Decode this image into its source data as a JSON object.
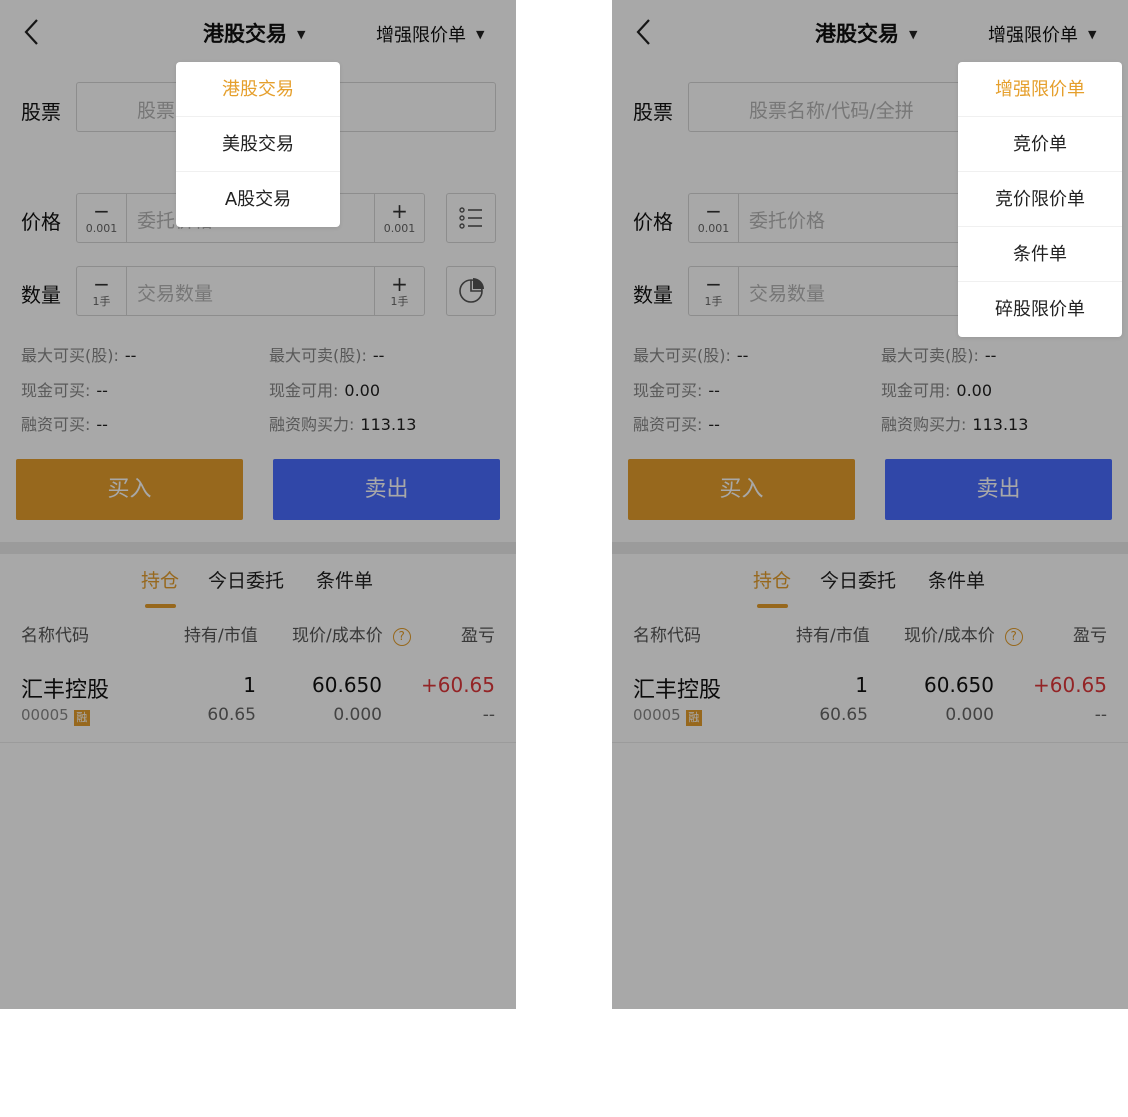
{
  "left": {
    "nav": {
      "title": "港股交易",
      "order_type": "增强限价单"
    },
    "form": {
      "stock_label": "股票",
      "stock_placeholder": "股票名称/代码/全拼",
      "price_label": "价格",
      "price_step": "0.001",
      "price_placeholder": "委托价格",
      "qty_label": "数量",
      "qty_step": "1手",
      "qty_placeholder": "交易数量"
    },
    "stats": {
      "max_buy_label": "最大可买(股):",
      "max_buy": "--",
      "max_sell_label": "最大可卖(股):",
      "max_sell": "--",
      "cash_buy_label": "现金可买:",
      "cash_buy": "--",
      "cash_avail_label": "现金可用:",
      "cash_avail": "0.00",
      "margin_buy_label": "融资可买:",
      "margin_buy": "--",
      "margin_power_label": "融资购买力:",
      "margin_power": "113.13"
    },
    "actions": {
      "buy": "买入",
      "sell": "卖出"
    },
    "tabs": [
      "持仓",
      "今日委托",
      "条件单"
    ],
    "table": {
      "headers": [
        "名称代码",
        "持有/市值",
        "现价/成本价",
        "盈亏"
      ],
      "help_icon": "?",
      "rows": [
        {
          "name": "汇丰控股",
          "code": "00005",
          "badge": "融",
          "hold": "1",
          "market_value": "60.65",
          "price": "60.650",
          "cost": "0.000",
          "pnl": "+60.65",
          "pnl_pct": "--"
        }
      ]
    },
    "menu": {
      "items": [
        "港股交易",
        "美股交易",
        "A股交易"
      ],
      "active_index": 0
    }
  },
  "right": {
    "nav": {
      "title": "港股交易",
      "order_type": "增强限价单"
    },
    "form": {
      "stock_label": "股票",
      "stock_placeholder": "股票名称/代码/全拼",
      "price_label": "价格",
      "price_step": "0.001",
      "price_placeholder": "委托价格",
      "qty_label": "数量",
      "qty_step": "1手",
      "qty_placeholder": "交易数量"
    },
    "stats": {
      "max_buy_label": "最大可买(股):",
      "max_buy": "--",
      "max_sell_label": "最大可卖(股):",
      "max_sell": "--",
      "cash_buy_label": "现金可买:",
      "cash_buy": "--",
      "cash_avail_label": "现金可用:",
      "cash_avail": "0.00",
      "margin_buy_label": "融资可买:",
      "margin_buy": "--",
      "margin_power_label": "融资购买力:",
      "margin_power": "113.13"
    },
    "actions": {
      "buy": "买入",
      "sell": "卖出"
    },
    "tabs": [
      "持仓",
      "今日委托",
      "条件单"
    ],
    "table": {
      "headers": [
        "名称代码",
        "持有/市值",
        "现价/成本价",
        "盈亏"
      ],
      "help_icon": "?",
      "rows": [
        {
          "name": "汇丰控股",
          "code": "00005",
          "badge": "融",
          "hold": "1",
          "market_value": "60.65",
          "price": "60.650",
          "cost": "0.000",
          "pnl": "+60.65",
          "pnl_pct": "--"
        }
      ]
    },
    "menu": {
      "items": [
        "增强限价单",
        "竞价单",
        "竞价限价单",
        "条件单",
        "碎股限价单"
      ],
      "active_index": 0
    }
  },
  "colors": {
    "accent": "#e59f2c",
    "buy": "#e59f2c",
    "sell": "#4a6cff",
    "loss_red": "#e0373b"
  }
}
